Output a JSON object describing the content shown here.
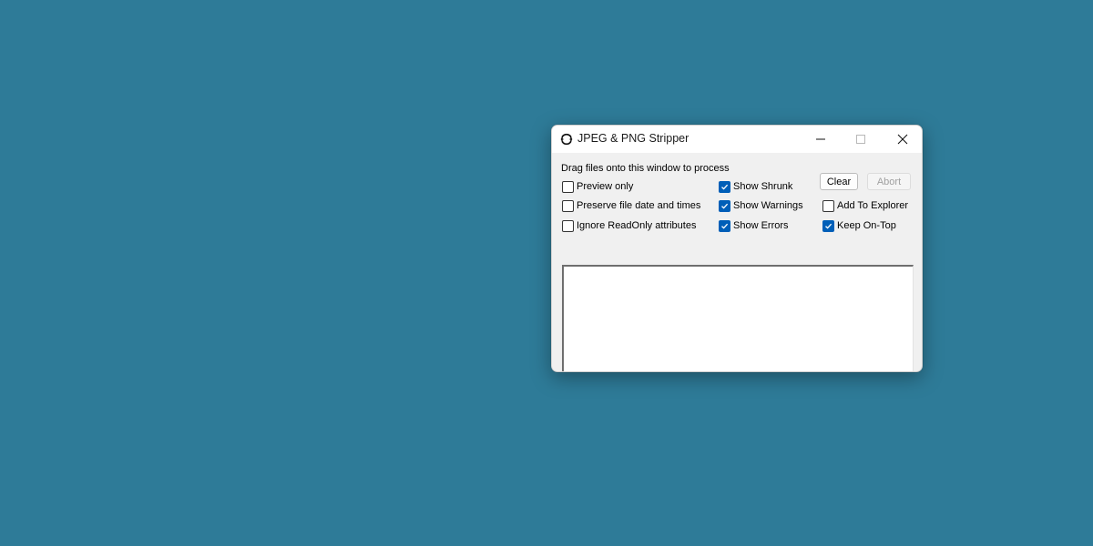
{
  "window": {
    "title": "JPEG & PNG Stripper"
  },
  "desktop": {
    "background": "#2e7b98"
  },
  "instructions": "Drag files onto this window to process",
  "options": {
    "preview_only": {
      "label": "Preview only",
      "checked": false
    },
    "preserve_dates": {
      "label": "Preserve file date and times",
      "checked": false
    },
    "ignore_readonly": {
      "label": "Ignore ReadOnly attributes",
      "checked": false
    },
    "show_shrunk": {
      "label": "Show Shrunk",
      "checked": true
    },
    "show_warnings": {
      "label": "Show Warnings",
      "checked": true
    },
    "show_errors": {
      "label": "Show Errors",
      "checked": true
    },
    "add_to_explorer": {
      "label": "Add To Explorer",
      "checked": false
    },
    "keep_on_top": {
      "label": "Keep On-Top",
      "checked": true
    }
  },
  "buttons": {
    "clear": {
      "label": "Clear",
      "enabled": true
    },
    "abort": {
      "label": "Abort",
      "enabled": false
    }
  },
  "colors": {
    "accent": "#005fb8"
  }
}
